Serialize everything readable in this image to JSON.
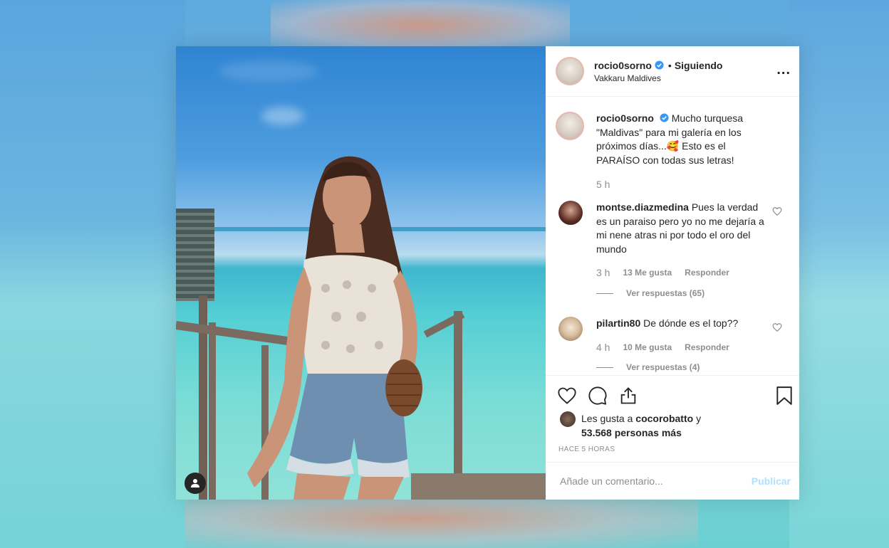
{
  "post": {
    "username": "rocio0sorno",
    "separator": "•",
    "following_label": "Siguiendo",
    "location": "Vakkaru Maldives",
    "more_label": "...",
    "caption": {
      "username": "rocio0sorno",
      "text": "Mucho turquesa \"Maldivas\" para mi galería en los próximos días...🥰 Esto es el PARAÍSO con todas sus letras!",
      "time": "5 h"
    },
    "comments": [
      {
        "username": "montse.diazmedina",
        "text": "Pues la verdad es un paraiso pero yo no me dejaría a mi nene atras ni por todo el oro del mundo",
        "time": "3 h",
        "likes": "13 Me gusta",
        "reply": "Responder",
        "view_replies": "Ver respuestas (65)"
      },
      {
        "username": "pilartin80",
        "text": "De dónde es el top??",
        "time": "4 h",
        "likes": "10 Me gusta",
        "reply": "Responder",
        "view_replies": "Ver respuestas (4)"
      }
    ],
    "likes": {
      "prefix": "Les gusta a",
      "user": "cocorobatto",
      "middle": "y",
      "count": "53.568 personas más"
    },
    "time_ago": "HACE 5 HORAS",
    "comment_placeholder": "Añade un comentario...",
    "publish_label": "Publicar"
  },
  "icons": {
    "verified": "verified-icon",
    "more": "more-icon",
    "like": "heart-icon",
    "comment": "comment-icon",
    "share": "share-icon",
    "save": "bookmark-icon",
    "profile": "user-icon"
  },
  "colors": {
    "verified_blue": "#3897f0",
    "text": "#262626",
    "secondary": "#8e8e8e",
    "publish_disabled": "#b2dffc"
  }
}
